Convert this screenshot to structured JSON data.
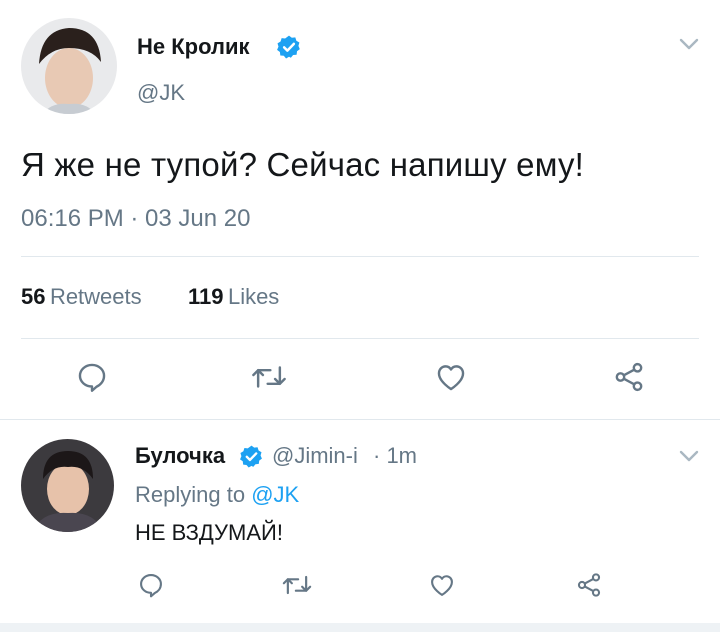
{
  "colors": {
    "accent": "#1da1f2",
    "secondary_text": "#657786",
    "primary_text": "#14171a",
    "divider": "#e1e8ed"
  },
  "main_tweet": {
    "author_name": "Не Кролик",
    "author_handle": "@JK",
    "verified_icon": "verified-badge-icon",
    "menu_icon": "chevron-down-icon",
    "text": "Я же не тупой? Сейчас напишу ему!",
    "timestamp": "06:16 PM · 03 Jun 20",
    "retweets_count": "56",
    "retweets_label": "Retweets",
    "likes_count": "119",
    "likes_label": "Likes",
    "actions": [
      "reply-icon",
      "retweet-icon",
      "like-icon",
      "share-icon"
    ]
  },
  "reply": {
    "author_name": "Булочка",
    "author_handle": "@Jimin-i",
    "time": "· 1m",
    "replying_prefix": "Replying to",
    "replying_to": "@JK",
    "text": "НЕ ВЗДУМАЙ!",
    "verified_icon": "verified-badge-icon",
    "menu_icon": "chevron-down-icon",
    "actions": [
      "reply-icon",
      "retweet-icon",
      "like-icon",
      "share-icon"
    ]
  }
}
